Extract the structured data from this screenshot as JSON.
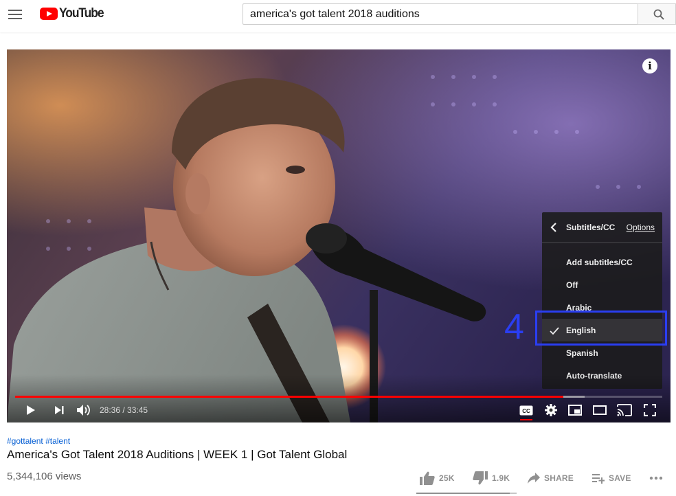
{
  "masthead": {
    "logo_text": "YouTube",
    "search_query": "america's got talent 2018 auditions"
  },
  "player": {
    "time_display": "28:36 / 33:45",
    "progress_fraction": 0.847,
    "buffered_fraction": 0.88,
    "subtitles_menu": {
      "title": "Subtitles/CC",
      "options_link": "Options",
      "items": [
        {
          "label": "Add subtitles/CC",
          "selected": false
        },
        {
          "label": "Off",
          "selected": false
        },
        {
          "label": "Arabic",
          "selected": false
        },
        {
          "label": "English",
          "selected": true
        },
        {
          "label": "Spanish",
          "selected": false
        },
        {
          "label": "Auto-translate",
          "selected": false
        }
      ]
    },
    "annotation_number": "4",
    "annotation_color": "#2a3ef2"
  },
  "video": {
    "hashtags": [
      "#gottalent",
      "#talent"
    ],
    "title": "America's Got Talent 2018 Auditions | WEEK 1 | Got Talent Global",
    "views": "5,344,106 views",
    "likes": "25K",
    "dislikes": "1.9K",
    "like_fraction": 0.93,
    "share_label": "SHARE",
    "save_label": "SAVE"
  },
  "colors": {
    "brand_red": "#ff0000",
    "link_blue": "#065fd4"
  }
}
